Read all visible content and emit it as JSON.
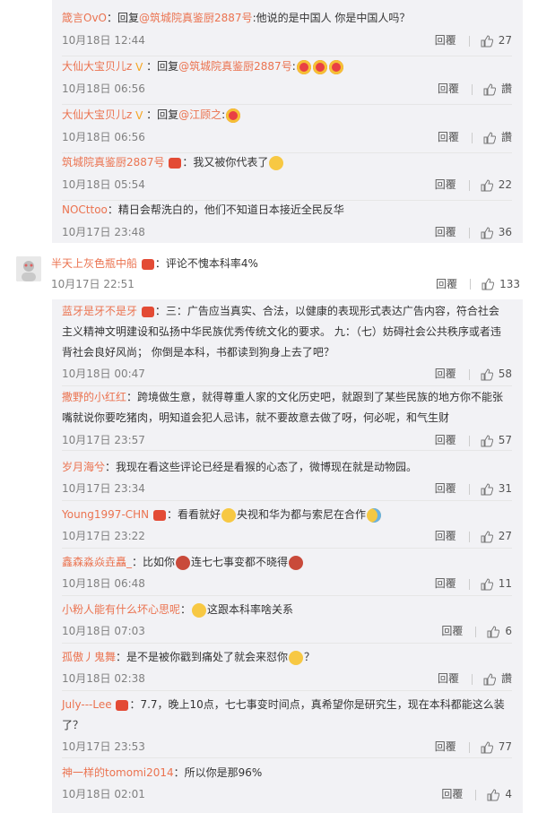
{
  "reply_label": "回覆",
  "accent_color": "#eb7350",
  "sub_a": [
    {
      "name": "箴言OvO",
      "text": "：回复",
      "mention": "@筑城院真鉴厨2887号",
      "rest": ":他说的是中国人 你是中国人吗？",
      "time": "10月18日 12:44",
      "likes": "27"
    },
    {
      "name": "大仙大宝贝儿z",
      "vip": "V",
      "text": "：回复",
      "mention": "@筑城院真鉴厨2887号",
      "rest": ":",
      "time": "10月18日 06:56",
      "likes": "讚",
      "emoji": [
        "heart",
        "heart",
        "heart"
      ]
    },
    {
      "name": "大仙大宝贝儿z",
      "vip": "V",
      "text": "：回复",
      "mention": "@江顾之",
      "rest": ":",
      "time": "10月18日 06:56",
      "likes": "讚",
      "emoji": [
        "heart"
      ]
    },
    {
      "name": "筑城院真鉴厨2887号",
      "badge": true,
      "text": "：我又被你代表了",
      "time": "10月18日 05:54",
      "likes": "22",
      "emoji": [
        "yellow"
      ]
    },
    {
      "name": "NOCttoo",
      "text": "：精日会帮洗白的，他们不知道日本接近全民反华",
      "time": "10月17日 23:48",
      "likes": "36"
    }
  ],
  "top": {
    "name": "半天上灰色瓶中船",
    "text": "：评论不愧本科率4%",
    "time": "10月17日 22:51",
    "likes": "133"
  },
  "sub_b": [
    {
      "name": "蓝牙是牙不是牙",
      "text": "：三：广告应当真实、合法，以健康的表现形式表达广告内容，符合社会",
      "line2": "主义精神文明建设和弘扬中华民族优秀传统文化的要求。 九：（七）妨碍社会公共秩序或者违",
      "line3": "背社会良好风尚； 你倒是本科，书都读到狗身上去了吧？",
      "time": "10月18日 00:47",
      "likes": "58"
    },
    {
      "name": "撒野的小红红",
      "text": "：跨境做生意，就得尊重人家的文化历史吧，就跟到了某些民族的地方你不能张",
      "line2": "嘴就说你要吃猪肉，明知道会犯人忌讳，就不要故意去做了呀，何必呢，和气生财",
      "time": "10月17日 23:57",
      "likes": "57"
    },
    {
      "name": "岁月海兮",
      "text": "：我现在看这些评论已经是看猴的心态了，微博现在就是动物园。",
      "time": "10月17日 23:34",
      "likes": "31"
    },
    {
      "name": "Young1997-CHN",
      "badge": true,
      "text": "：看看就好",
      "mid": "央视和华为都与索尼在合作",
      "time": "10月17日 23:22",
      "likes": "27"
    },
    {
      "name": "鑫森淼焱垚矗_",
      "text": "：比如你",
      "mid": "连七七事变都不晓得",
      "time": "10月18日 06:48",
      "likes": "11"
    },
    {
      "name": "小粉人能有什么坏心思呢",
      "text": "：",
      "mid": "这跟本科率啥关系",
      "time": "10月18日 07:03",
      "likes": "6"
    },
    {
      "name": "孤傲丿鬼舞",
      "text": "：是不是被你戳到痛处了就会来怼你",
      "tail": "？",
      "time": "10月18日 02:38",
      "likes": "讚"
    },
    {
      "name": "July---Lee",
      "badge": true,
      "text": "：7.7，晚上10点，七七事变时间点，真希望你是研究生，现在本科都能这么装",
      "line2": "了？",
      "time": "10月17日 23:53",
      "likes": "77"
    },
    {
      "name": "神一样的tomomi2014",
      "text": "：所以你是那96%",
      "time": "10月18日 02:01",
      "likes": "4"
    }
  ]
}
